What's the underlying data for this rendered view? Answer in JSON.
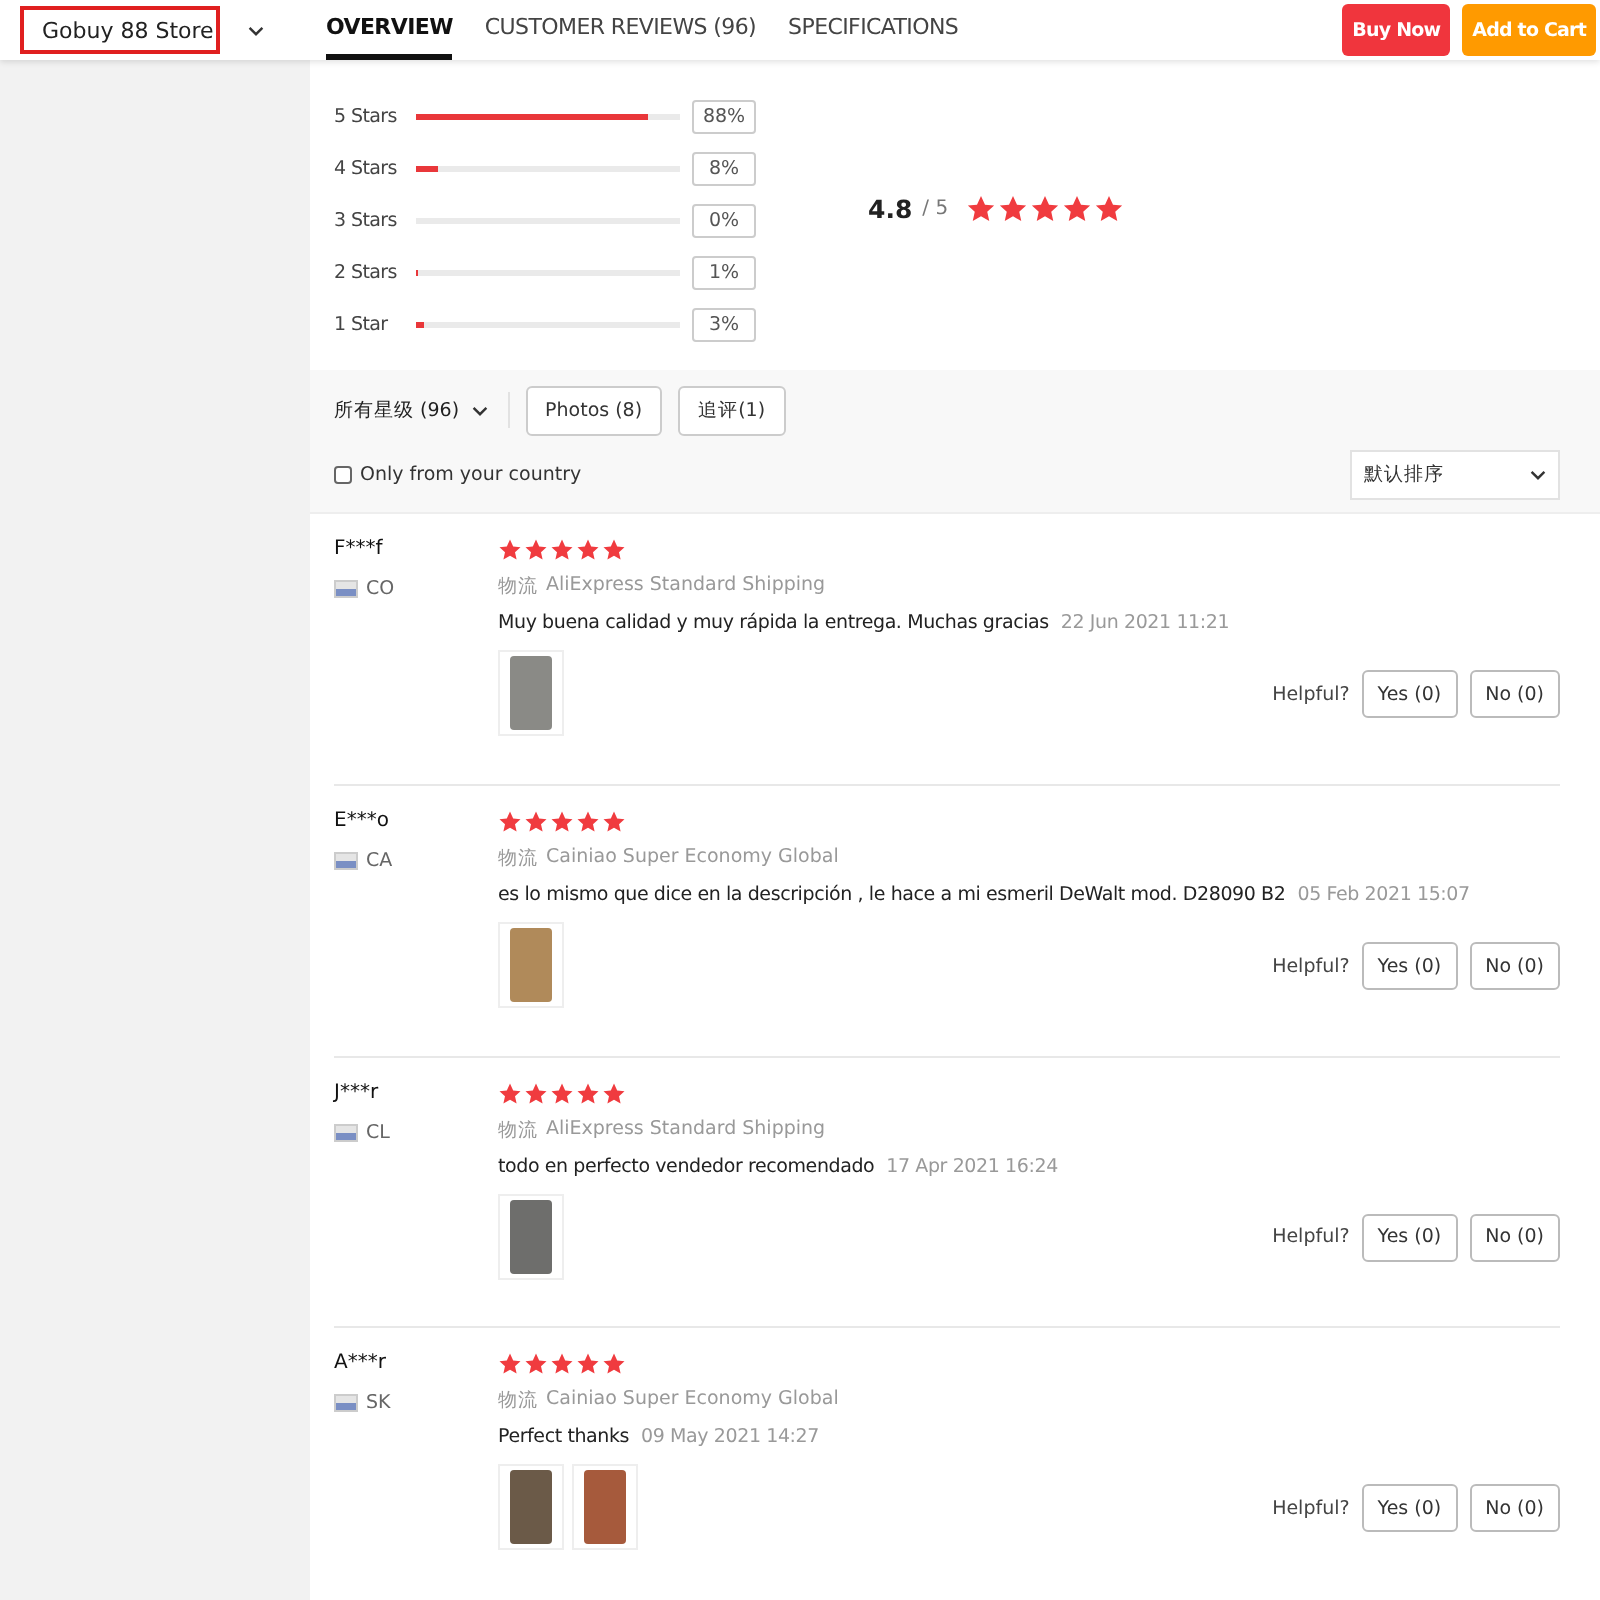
{
  "store_select": {
    "value": "Gobuy 88 Store"
  },
  "tabs": [
    {
      "label": "OVERVIEW",
      "selected": true
    },
    {
      "label": "CUSTOMER REVIEWS (96)",
      "selected": false
    },
    {
      "label": "SPECIFICATIONS",
      "selected": false
    }
  ],
  "actions": [
    {
      "label": "Buy Now",
      "kind": "buy"
    },
    {
      "label": "Add to Cart",
      "kind": "cart"
    }
  ],
  "rating_breakdown": [
    {
      "label": "5 Stars",
      "level": 0.88,
      "percent": "88%"
    },
    {
      "label": "4 Stars",
      "level": 0.08,
      "percent": "8%"
    },
    {
      "label": "3 Stars",
      "level": 0,
      "percent": "0%"
    },
    {
      "label": "2 Stars",
      "level": 0.01,
      "percent": "1%"
    },
    {
      "label": "1 Star",
      "level": 0.03,
      "percent": "3%"
    }
  ],
  "rating_summary": {
    "score": "4.8",
    "out_of": "/ 5",
    "stars": 5
  },
  "filters": {
    "star_filter": "所有星级 (96)",
    "buttons": [
      "Photos (8)",
      "追评(1)"
    ],
    "country_checkbox": {
      "label": "Only from your country",
      "checked": false
    },
    "sort": "默认排序"
  },
  "reviews": [
    {
      "name": "F***f",
      "country": "CO",
      "stars": 5,
      "shipping_label": "物流",
      "shipping": "AliExpress Standard Shipping",
      "text": "Muy buena calidad y muy rápida la entrega. Muchas gracias",
      "date": "22 Jun 2021 11:21",
      "photos": [
        {
          "color": "#8a8a86"
        }
      ],
      "helpful": "Helpful?",
      "yes": "Yes (0)",
      "no": "No (0)"
    },
    {
      "name": "E***o",
      "country": "CA",
      "stars": 5,
      "shipping_label": "物流",
      "shipping": "Cainiao Super Economy Global",
      "text": "es lo mismo que dice en la descripción , le hace a mi esmeril DeWalt mod. D28090 B2",
      "date": "05 Feb 2021 15:07",
      "photos": [
        {
          "color": "#b08a5a"
        }
      ],
      "helpful": "Helpful?",
      "yes": "Yes (0)",
      "no": "No (0)"
    },
    {
      "name": "J***r",
      "country": "CL",
      "stars": 5,
      "shipping_label": "物流",
      "shipping": "AliExpress Standard Shipping",
      "text": "todo en perfecto vendedor recomendado",
      "date": "17 Apr 2021 16:24",
      "photos": [
        {
          "color": "#6e6e6c"
        }
      ],
      "helpful": "Helpful?",
      "yes": "Yes (0)",
      "no": "No (0)"
    },
    {
      "name": "A***r",
      "country": "SK",
      "stars": 5,
      "shipping_label": "物流",
      "shipping": "Cainiao Super Economy Global",
      "text": "Perfect thanks",
      "date": "09 May 2021 14:27",
      "photos": [
        {
          "color": "#6b5a48"
        },
        {
          "color": "#a65a3c"
        }
      ],
      "helpful": "Helpful?",
      "yes": "Yes (0)",
      "no": "No (0)"
    }
  ]
}
